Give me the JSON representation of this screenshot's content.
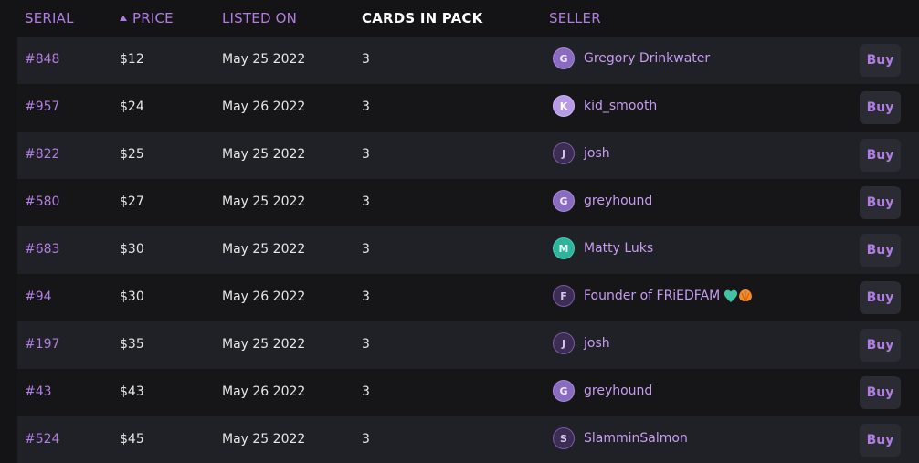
{
  "header": {
    "serial": "SERIAL",
    "price": "PRICE",
    "listed_on": "LISTED ON",
    "cards_in_pack": "CARDS IN PACK",
    "seller": "SELLER"
  },
  "rows": [
    {
      "serial": "#848",
      "price": "$12",
      "listed": "May 25 2022",
      "cards": "3",
      "seller": "Gregory Drinkwater",
      "avatar": "G",
      "buy": "Buy"
    },
    {
      "serial": "#957",
      "price": "$24",
      "listed": "May 26 2022",
      "cards": "3",
      "seller": "kid_smooth",
      "avatar": "K",
      "buy": "Buy"
    },
    {
      "serial": "#822",
      "price": "$25",
      "listed": "May 25 2022",
      "cards": "3",
      "seller": "josh",
      "avatar": "J",
      "buy": "Buy"
    },
    {
      "serial": "#580",
      "price": "$27",
      "listed": "May 25 2022",
      "cards": "3",
      "seller": "greyhound",
      "avatar": "G",
      "buy": "Buy"
    },
    {
      "serial": "#683",
      "price": "$30",
      "listed": "May 25 2022",
      "cards": "3",
      "seller": "Matty Luks",
      "avatar": "M",
      "buy": "Buy"
    },
    {
      "serial": "#94",
      "price": "$30",
      "listed": "May 26 2022",
      "cards": "3",
      "seller": "Founder of FRiEDFAM",
      "avatar": "F",
      "buy": "Buy"
    },
    {
      "serial": "#197",
      "price": "$35",
      "listed": "May 25 2022",
      "cards": "3",
      "seller": "josh",
      "avatar": "J",
      "buy": "Buy"
    },
    {
      "serial": "#43",
      "price": "$43",
      "listed": "May 26 2022",
      "cards": "3",
      "seller": "greyhound",
      "avatar": "G",
      "buy": "Buy"
    },
    {
      "serial": "#524",
      "price": "$45",
      "listed": "May 25 2022",
      "cards": "3",
      "seller": "SlamminSalmon",
      "avatar": "S",
      "buy": "Buy"
    }
  ],
  "colors": {
    "accent": "#b07ee0",
    "background": "#141416",
    "row_odd": "#202126",
    "row_even": "#161619"
  },
  "icons": {
    "sort": "sort-up-icon",
    "seller_badge_emojis": [
      "green-heart-emoji",
      "orange-shell-emoji"
    ]
  }
}
